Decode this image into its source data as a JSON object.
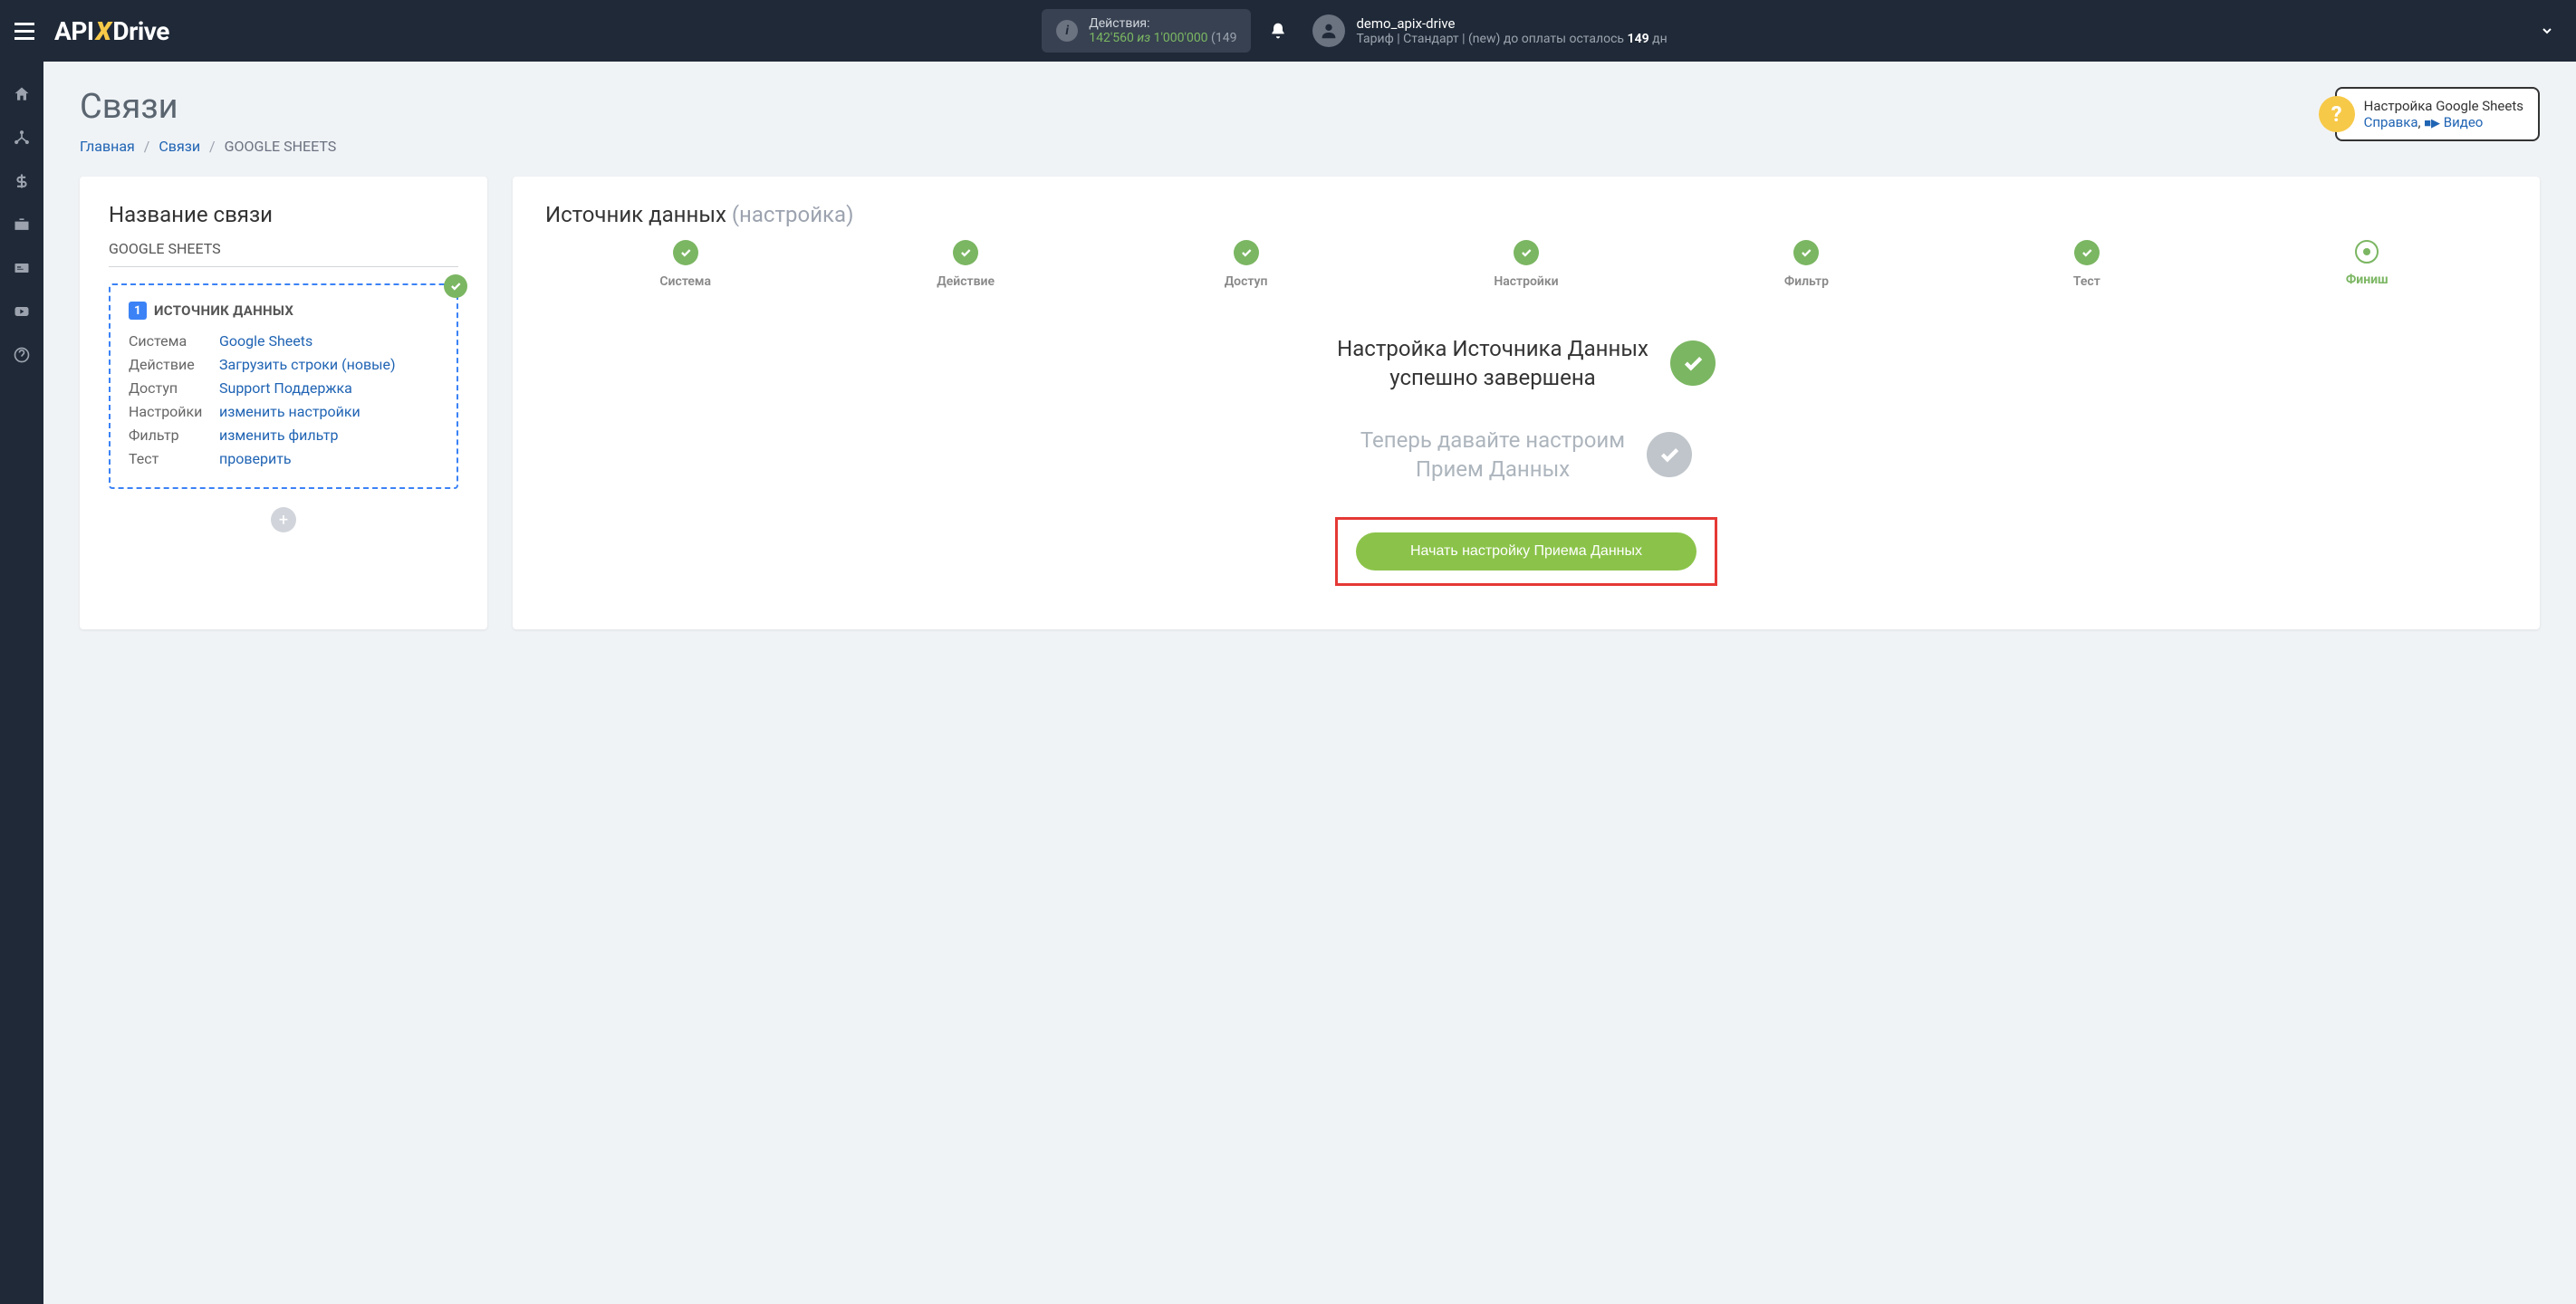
{
  "header": {
    "logo_parts": {
      "a": "API",
      "x": "X",
      "d": "Drive"
    },
    "actions_label": "Действия:",
    "actions_used": "142'560",
    "actions_of": "из",
    "actions_total": "1'000'000",
    "actions_rest": "(149",
    "username": "demo_apix-drive",
    "tariff_prefix": "Тариф | Стандарт |  (new) до оплаты осталось",
    "days": "149",
    "days_suffix": "дн"
  },
  "page": {
    "title": "Связи",
    "breadcrumb_home": "Главная",
    "breadcrumb_links": "Связи",
    "breadcrumb_current": "GOOGLE SHEETS"
  },
  "help": {
    "title": "Настройка Google Sheets",
    "link1": "Справка",
    "comma": ",",
    "link2": "Видео"
  },
  "left_panel": {
    "heading": "Название связи",
    "conn_name": "GOOGLE SHEETS",
    "source_title": "ИСТОЧНИК ДАННЫХ",
    "rows": {
      "system": {
        "label": "Система",
        "value": "Google Sheets"
      },
      "action": {
        "label": "Действие",
        "value": "Загрузить строки (новые)"
      },
      "access": {
        "label": "Доступ",
        "value": "Support Поддержка"
      },
      "settings": {
        "label": "Настройки",
        "value": "изменить настройки"
      },
      "filter": {
        "label": "Фильтр",
        "value": "изменить фильтр"
      },
      "test": {
        "label": "Тест",
        "value": "проверить"
      }
    }
  },
  "right_panel": {
    "heading": "Источник данных",
    "heading_sub": "(настройка)",
    "steps": [
      {
        "label": "Система",
        "state": "done"
      },
      {
        "label": "Действие",
        "state": "done"
      },
      {
        "label": "Доступ",
        "state": "done"
      },
      {
        "label": "Настройки",
        "state": "done"
      },
      {
        "label": "Фильтр",
        "state": "done"
      },
      {
        "label": "Тест",
        "state": "done"
      },
      {
        "label": "Финиш",
        "state": "current"
      }
    ],
    "status1_line1": "Настройка Источника Данных",
    "status1_line2": "успешно завершена",
    "status2_line1": "Теперь давайте настроим",
    "status2_line2": "Прием Данных",
    "cta": "Начать настройку Приема Данных"
  }
}
